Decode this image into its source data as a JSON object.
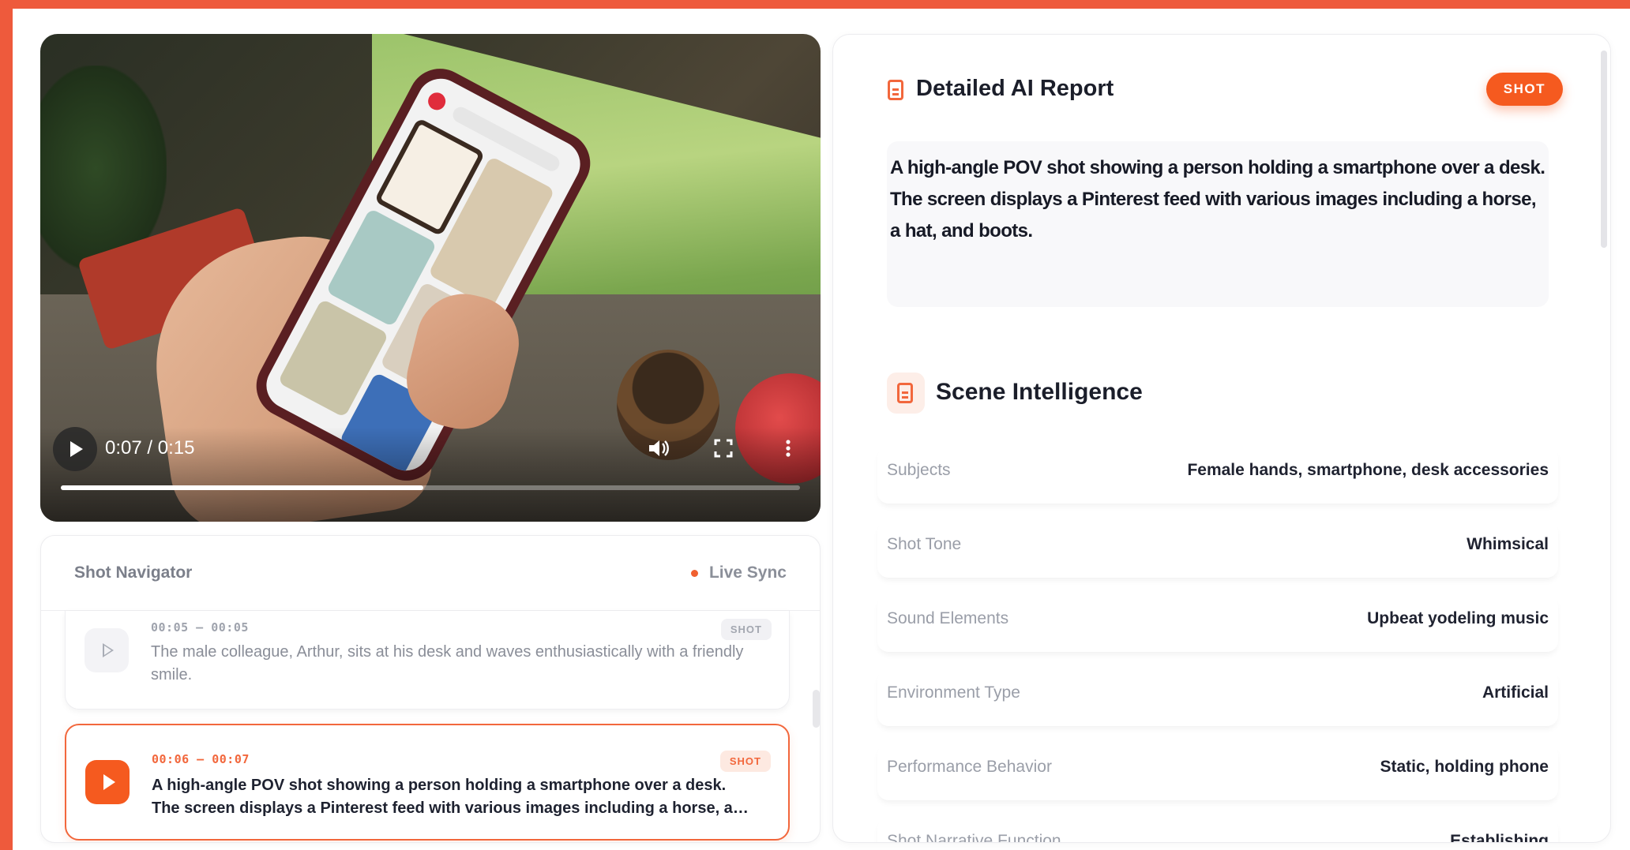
{
  "player": {
    "time_display": "0:07 / 0:15",
    "progress_fraction": 0.49,
    "icons": {
      "play": "play-icon",
      "volume": "volume-icon",
      "fullscreen": "fullscreen-icon",
      "more": "more-vertical-icon"
    }
  },
  "navigator": {
    "title": "Shot Navigator",
    "sync_label": "Live Sync",
    "shots": [
      {
        "time": "00:05 – 00:05",
        "badge": "SHOT",
        "description": "The male colleague, Arthur, sits at his desk and waves enthusiastically with a friendly smile."
      },
      {
        "time": "00:06 – 00:07",
        "badge": "SHOT",
        "description": "A high-angle POV shot showing a person holding a smartphone over a desk. The screen displays a Pinterest feed with various images including a horse, a hat, and boots."
      }
    ]
  },
  "report": {
    "title": "Detailed AI Report",
    "badge": "SHOT",
    "summary": "A high-angle POV shot showing a person holding a smartphone over a desk. The screen displays a Pinterest feed with various images including a horse, a hat, and boots.",
    "scene_title": "Scene Intelligence",
    "attributes": [
      {
        "label": "Subjects",
        "value": "Female hands, smartphone, desk accessories"
      },
      {
        "label": "Shot Tone",
        "value": "Whimsical"
      },
      {
        "label": "Sound Elements",
        "value": "Upbeat yodeling music"
      },
      {
        "label": "Environment Type",
        "value": "Artificial"
      },
      {
        "label": "Performance Behavior",
        "value": "Static, holding phone"
      },
      {
        "label": "Shot Narrative Function",
        "value": "Establishing"
      }
    ]
  },
  "colors": {
    "accent": "#f2673c",
    "frame": "#ee5a3c"
  }
}
